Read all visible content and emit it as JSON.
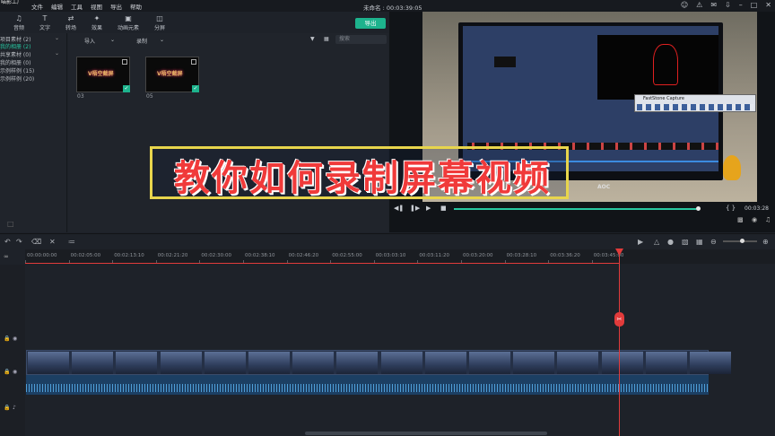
{
  "app": {
    "logo": "喵影工厂",
    "menu": [
      "文件",
      "编辑",
      "工具",
      "视图",
      "导出",
      "帮助"
    ],
    "doc_title": "未命名 : 00:03:39:05"
  },
  "toolbar": {
    "tools": [
      {
        "label": "音频",
        "icon": "music-note-icon"
      },
      {
        "label": "文字",
        "icon": "text-icon"
      },
      {
        "label": "转场",
        "icon": "transition-icon"
      },
      {
        "label": "效果",
        "icon": "effects-icon"
      },
      {
        "label": "动画元素",
        "icon": "element-icon"
      },
      {
        "label": "分屏",
        "icon": "split-screen-icon"
      }
    ],
    "export_label": "导出"
  },
  "library": {
    "items": [
      {
        "label": "项目素材 (2)",
        "active": false
      },
      {
        "label": "我的相册 (2)",
        "active": true
      },
      {
        "label": "共享素材 (0)",
        "active": false
      },
      {
        "label": "我的相册 (0)",
        "active": false
      },
      {
        "label": "示例样例 (15)",
        "active": false
      },
      {
        "label": "示例样例 (20)",
        "active": false
      }
    ]
  },
  "media": {
    "import_label": "导入",
    "record_label": "录制",
    "search_placeholder": "搜索",
    "clips": [
      {
        "name": "03",
        "thumb_text": "V梧空截屏"
      },
      {
        "name": "05",
        "thumb_text": "V梧空截屏"
      }
    ]
  },
  "preview": {
    "fsc_title": "FastStone Capture",
    "brand": "AOC",
    "timecode": "00:03:28",
    "progress_fraction": 0.99
  },
  "banner": {
    "text": "教你如何录制屏幕视频"
  },
  "timeline": {
    "ruler_ticks": [
      "00:00:00:00",
      "00:02:05:00",
      "00:02:13:10",
      "00:02:21:20",
      "00:02:30:00",
      "00:02:38:10",
      "00:02:46:20",
      "00:02:55:00",
      "00:03:03:10",
      "00:03:11:20",
      "00:03:20:00",
      "00:03:28:10",
      "00:03:36:20",
      "00:03:45:00"
    ],
    "zoom_fraction": 0.5
  },
  "colors": {
    "accent": "#1db38d",
    "playhead": "#e23b3b",
    "banner_text": "#f03a3a",
    "banner_border": "#e8d54c"
  }
}
